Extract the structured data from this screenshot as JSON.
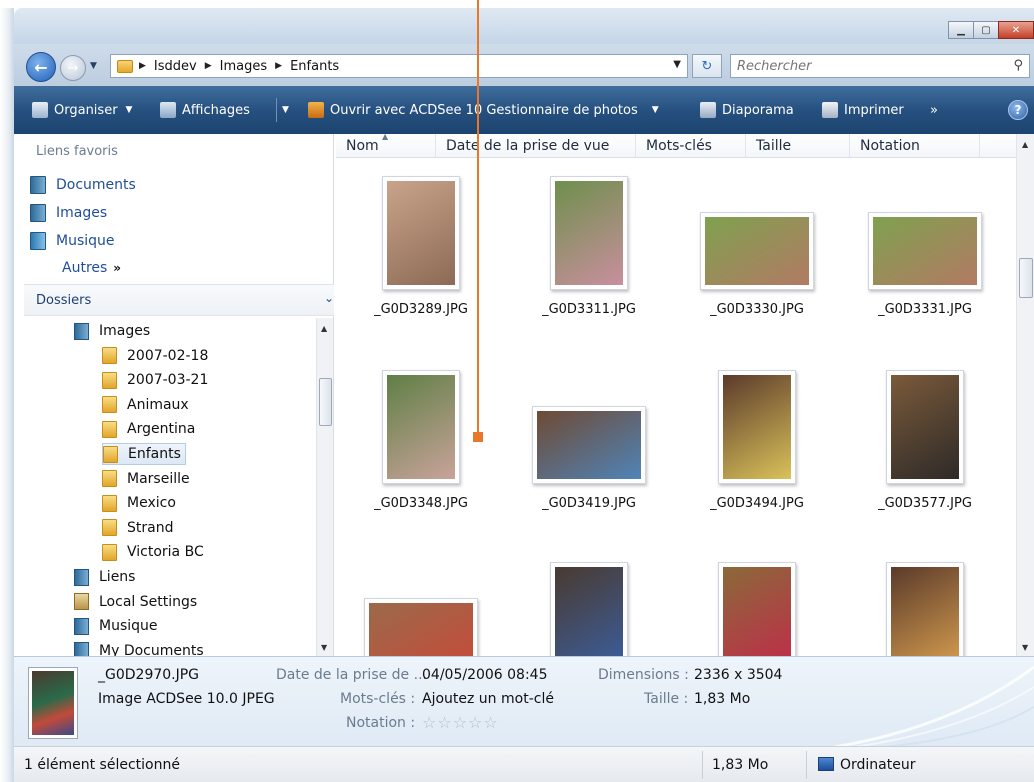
{
  "address": {
    "crumbs": [
      "Isddev",
      "Images",
      "Enfants"
    ],
    "search_placeholder": "Rechercher"
  },
  "toolbar": {
    "organize": "Organiser",
    "views": "Affichages",
    "open_with": "Ouvrir avec ACDSee 10 Gestionnaire de photos",
    "slideshow": "Diaporama",
    "print": "Imprimer",
    "more": "»",
    "help": "?"
  },
  "nav": {
    "favorites_title": "Liens favoris",
    "favorites": [
      "Documents",
      "Images",
      "Musique"
    ],
    "more": "Autres",
    "more_glyph": "»",
    "folders_title": "Dossiers",
    "tree": [
      {
        "label": "Images",
        "icon": "library-icon"
      },
      {
        "label": "2007-02-18",
        "icon": "folder-icon"
      },
      {
        "label": "2007-03-21",
        "icon": "folder-icon"
      },
      {
        "label": "Animaux",
        "icon": "folder-icon"
      },
      {
        "label": "Argentina",
        "icon": "folder-icon"
      },
      {
        "label": "Enfants",
        "icon": "folder-icon",
        "selected": true
      },
      {
        "label": "Marseille",
        "icon": "folder-icon"
      },
      {
        "label": "Mexico",
        "icon": "folder-icon"
      },
      {
        "label": "Strand",
        "icon": "folder-icon"
      },
      {
        "label": "Victoria BC",
        "icon": "folder-icon"
      },
      {
        "label": "Liens",
        "icon": "library-icon"
      },
      {
        "label": "Local Settings",
        "icon": "settings-folder-icon"
      },
      {
        "label": "Musique",
        "icon": "music-icon"
      },
      {
        "label": "My Documents",
        "icon": "library-icon"
      }
    ]
  },
  "columns": [
    "Nom",
    "Date de la prise de vue",
    "Mots-clés",
    "Taille",
    "Notation"
  ],
  "files": [
    {
      "name": "_G0D3289.JPG",
      "colors": [
        "#c9a48b",
        "#8c6a55"
      ]
    },
    {
      "name": "_G0D3311.JPG",
      "colors": [
        "#6e8f4c",
        "#c98f9e"
      ]
    },
    {
      "name": "_G0D3330.JPG",
      "colors": [
        "#7fa14f",
        "#b27a64"
      ]
    },
    {
      "name": "_G0D3331.JPG",
      "colors": [
        "#7fa14f",
        "#b27a64"
      ]
    },
    {
      "name": "_G0D3348.JPG",
      "colors": [
        "#5f7f45",
        "#c9a39b"
      ]
    },
    {
      "name": "_G0D3419.JPG",
      "colors": [
        "#6f4a34",
        "#4f84b8"
      ]
    },
    {
      "name": "_G0D3494.JPG",
      "colors": [
        "#5b3a2b",
        "#d9c25a"
      ]
    },
    {
      "name": "_G0D3577.JPG",
      "colors": [
        "#7a5a3a",
        "#2e2a28"
      ]
    },
    {
      "name": "",
      "colors": [
        "#9a6a4a",
        "#c84a3a"
      ]
    },
    {
      "name": "",
      "colors": [
        "#4a3a30",
        "#3a5fa0"
      ]
    },
    {
      "name": "",
      "colors": [
        "#8a6a3a",
        "#c22a4a"
      ]
    },
    {
      "name": "",
      "colors": [
        "#5a3a2a",
        "#d9a050"
      ]
    }
  ],
  "details": {
    "name": "_G0D2970.JPG",
    "type": "Image ACDSee 10.0 JPEG",
    "date_label": "Date de la prise de ...",
    "date_value": "04/05/2006 08:45",
    "keywords_label": "Mots-clés :",
    "keywords_value": "Ajoutez un mot-clé",
    "rating_label": "Notation :",
    "rating_stars": "☆☆☆☆☆",
    "dimensions_label": "Dimensions :",
    "dimensions_value": "2336 x 3504",
    "size_label": "Taille :",
    "size_value": "1,83 Mo"
  },
  "status": {
    "selected": "1 élément sélectionné",
    "size": "1,83 Mo",
    "location": "Ordinateur"
  },
  "colors": {
    "toolbar": "#26507f",
    "link": "#1f4e9a",
    "annotation": "#e8772b"
  }
}
